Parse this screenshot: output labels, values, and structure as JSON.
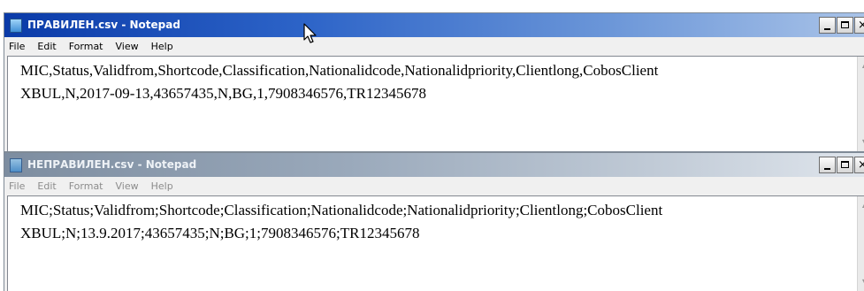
{
  "windows": [
    {
      "title": "ПРАВИЛЕН.csv - Notepad",
      "menu": [
        "File",
        "Edit",
        "Format",
        "View",
        "Help"
      ],
      "lines": [
        "MIC,Status,Validfrom,Shortcode,Classification,Nationalidcode,Nationalidpriority,Clientlong,CobosClient",
        "XBUL,N,2017-09-13,43657435,N,BG,1,7908346576,TR12345678"
      ],
      "active": true
    },
    {
      "title": "НЕПРАВИЛЕН.csv - Notepad",
      "menu": [
        "File",
        "Edit",
        "Format",
        "View",
        "Help"
      ],
      "lines": [
        "MIC;Status;Validfrom;Shortcode;Classification;Nationalidcode;Nationalidpriority;Clientlong;CobosClient",
        "XBUL;N;13.9.2017;43657435;N;BG;1;7908346576;TR12345678"
      ],
      "active": false
    }
  ],
  "icons": {
    "app": "notepad-icon",
    "minimize": "minimize-icon",
    "maximize": "maximize-icon",
    "close": "close-icon",
    "close_glyph": "×",
    "scroll_up": "▲",
    "scroll_down": "▼",
    "cursor": "mouse-pointer-icon"
  }
}
